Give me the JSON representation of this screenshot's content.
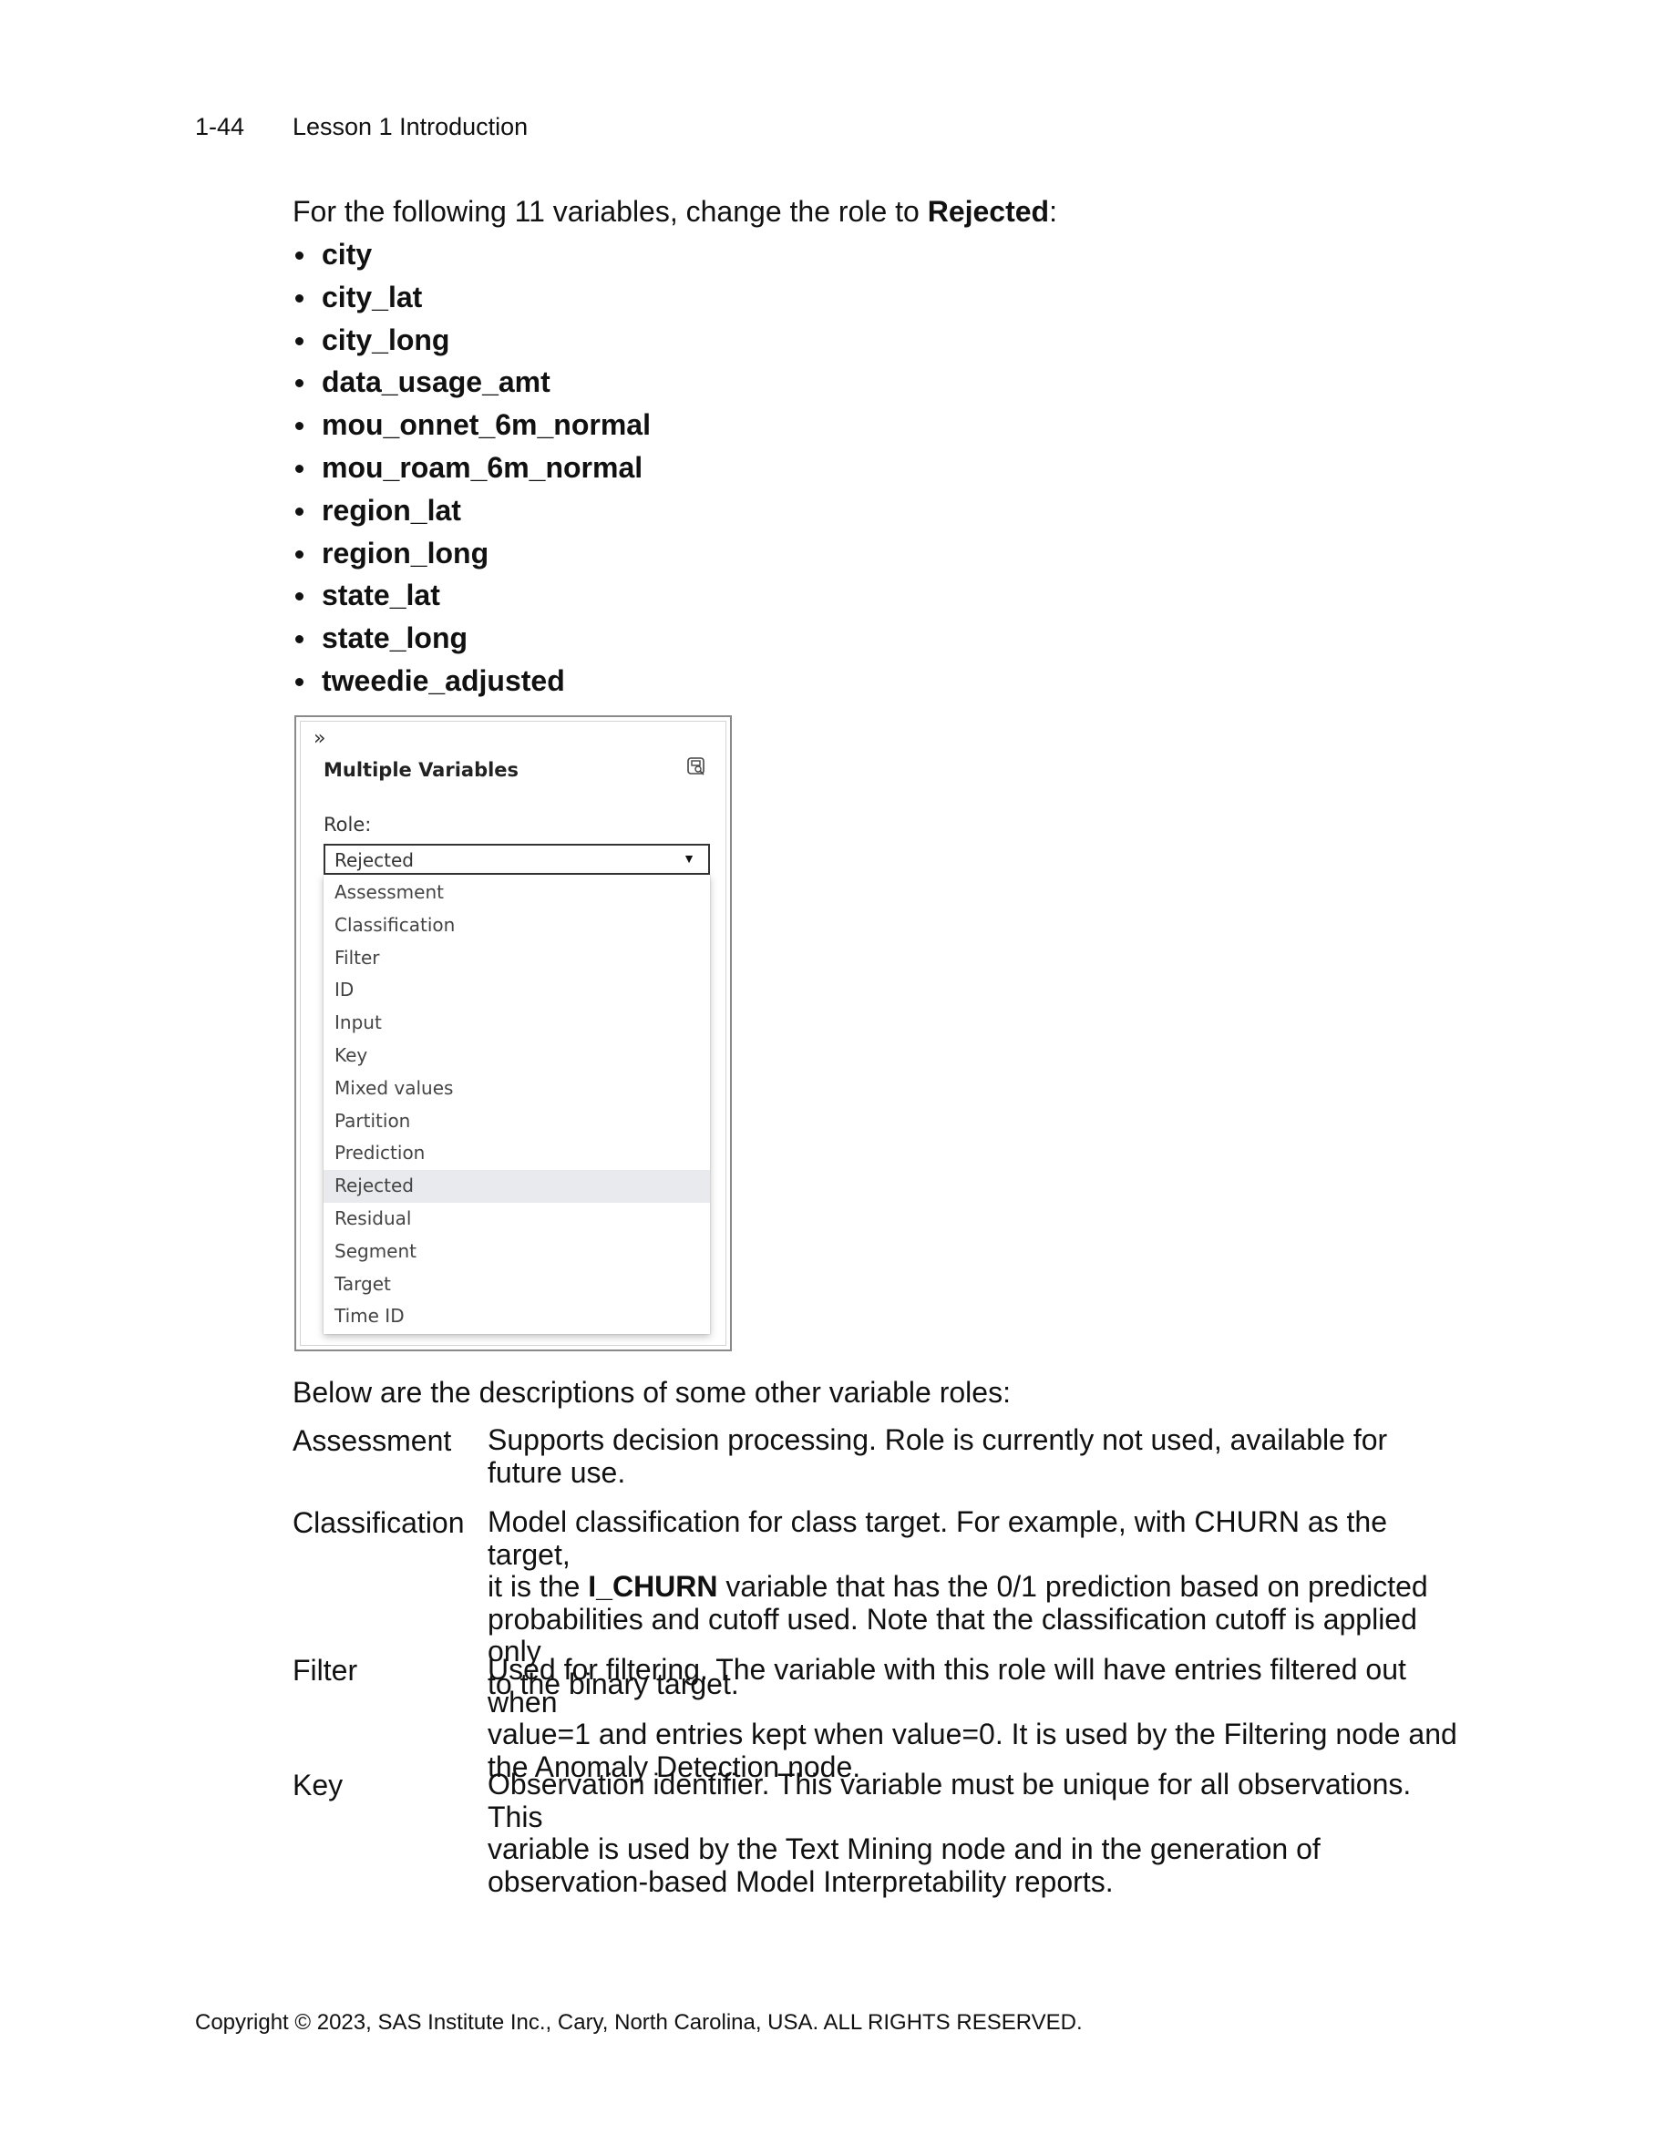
{
  "header": {
    "page_number": "1-44",
    "lesson_title": "Lesson 1  Introduction"
  },
  "intro": {
    "prefix": "For the following 11 variables, change the role to ",
    "role": "Rejected",
    "suffix": ":"
  },
  "variables": [
    "city",
    "city_lat",
    "city_long",
    "data_usage_amt",
    "mou_onnet_6m_normal",
    "mou_roam_6m_normal",
    "region_lat",
    "region_long",
    "state_lat",
    "state_long",
    "tweedie_adjusted"
  ],
  "panel": {
    "collapse_glyph": "»",
    "title": "Multiple Variables",
    "role_label": "Role:",
    "selected_value": "Rejected",
    "options": [
      "Assessment",
      "Classification",
      "Filter",
      "ID",
      "Input",
      "Key",
      "Mixed values",
      "Partition",
      "Prediction",
      "Rejected",
      "Residual",
      "Segment",
      "Target",
      "Time ID"
    ],
    "highlighted_option": "Rejected"
  },
  "descriptions": {
    "intro": "Below are the descriptions of some other variable roles:",
    "assessment": {
      "term": "Assessment",
      "line1": "Supports decision processing. Role is currently not used, available for",
      "line2": "future use."
    },
    "classification": {
      "term": "Classification",
      "line1": "Model classification for class target. For example, with CHURN as the target,",
      "line2_prefix": "it is the ",
      "line2_bold": "I_CHURN",
      "line2_suffix": " variable that has the 0/1 prediction based on predicted",
      "line3": "probabilities and cutoff used. Note that the classification cutoff is applied only",
      "line4": "to the binary target."
    },
    "filter": {
      "term": "Filter",
      "line1": "Used for filtering. The variable with this role will have entries filtered out when",
      "line2": "value=1 and entries kept when value=0. It is used by the Filtering node and",
      "line3": "the Anomaly Detection node."
    },
    "key": {
      "term": "Key",
      "line1": "Observation identifier. This variable must be unique for all observations. This",
      "line2": "variable is used by the Text Mining node and in the generation of",
      "line3": "observation-based Model Interpretability reports."
    }
  },
  "footer": {
    "copyright": "Copyright © 2023, SAS Institute Inc., Cary, North Carolina, USA. ALL RIGHTS RESERVED."
  }
}
